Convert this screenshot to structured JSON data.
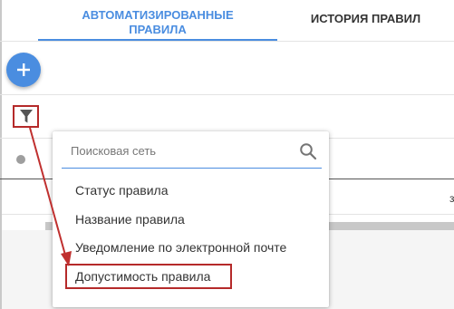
{
  "tabs": [
    {
      "label_line1": "АВТОМАТИЗИРОВАННЫЕ",
      "label_line2": "ПРАВИЛА",
      "active": true
    },
    {
      "label": "ИСТОРИЯ ПРАВИЛ",
      "active": false
    }
  ],
  "fab": {
    "icon": "plus-icon"
  },
  "filter": {
    "icon": "filter-funnel-icon"
  },
  "dropdown": {
    "search_placeholder": "Поисковая сеть",
    "search_icon": "search-icon",
    "items": [
      "Статус правила",
      "Название правила",
      "Уведомление по электронной почте",
      "Допустимость правила"
    ]
  },
  "partial_text": "з",
  "colors": {
    "accent": "#4a8de0",
    "highlight": "#b52a2a"
  }
}
